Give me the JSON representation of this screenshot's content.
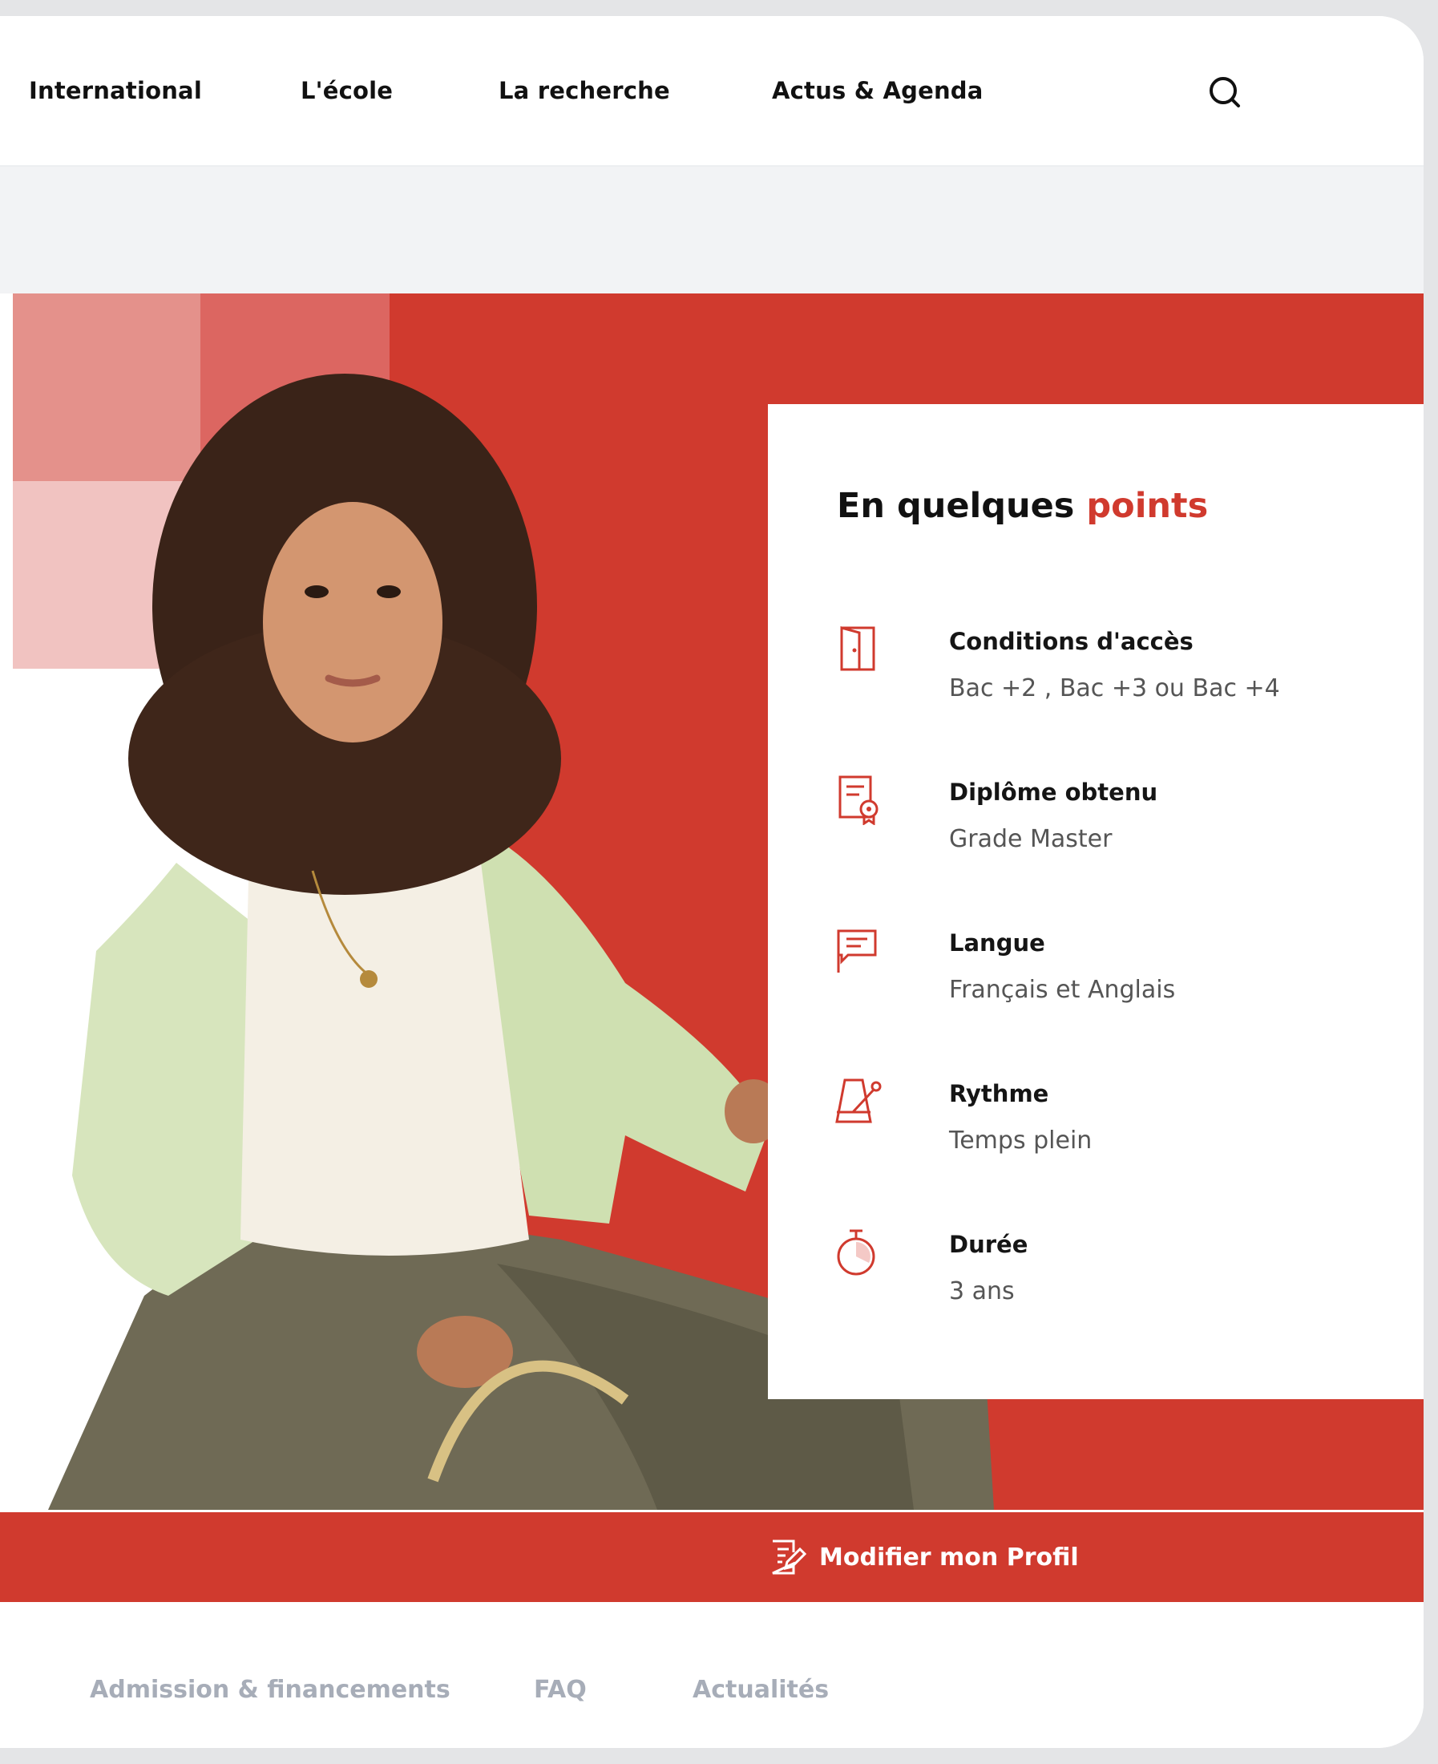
{
  "nav": {
    "items": [
      "International",
      "L'école",
      "La recherche",
      "Actus & Agenda"
    ],
    "search_icon": "search-icon"
  },
  "card": {
    "title_main": "En quelques ",
    "title_accent": "points",
    "points": [
      {
        "icon": "door-icon",
        "label": "Conditions d'accès",
        "value": "Bac +2 , Bac +3 ou Bac +4"
      },
      {
        "icon": "diploma-icon",
        "label": "Diplôme obtenu",
        "value": "Grade Master"
      },
      {
        "icon": "speech-flag-icon",
        "label": "Langue",
        "value": "Français et Anglais"
      },
      {
        "icon": "metronome-icon",
        "label": "Rythme",
        "value": "Temps plein"
      },
      {
        "icon": "stopwatch-icon",
        "label": "Durée",
        "value": "3 ans"
      }
    ]
  },
  "profile": {
    "button_label": "Modifier mon Profil",
    "icon": "edit-profile-icon"
  },
  "tabs": [
    "Admission & financements",
    "FAQ",
    "Actualités"
  ],
  "colors": {
    "accent": "#d03a2e",
    "tab_text": "#a7adb8",
    "band": "#f2f3f5"
  }
}
